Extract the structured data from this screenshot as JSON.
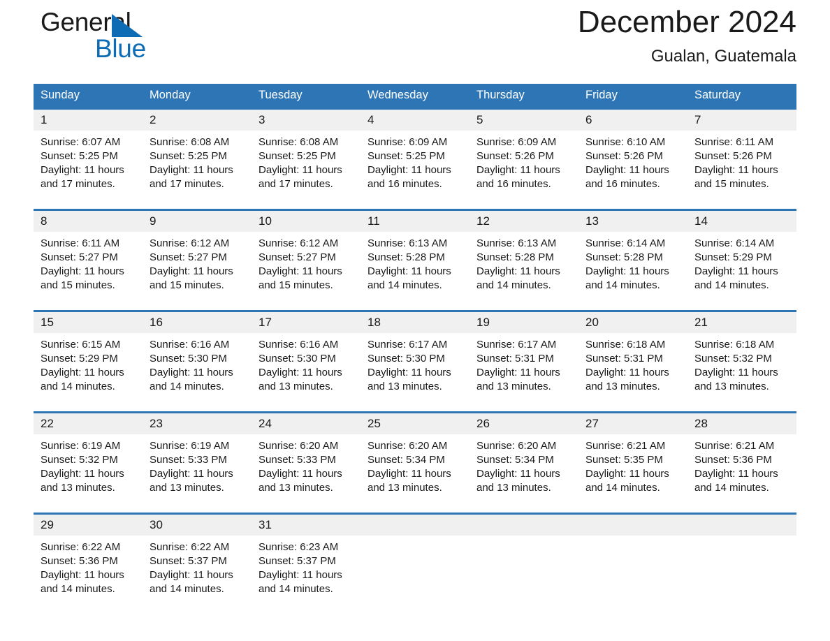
{
  "brand": {
    "word1": "General",
    "word2": "Blue",
    "triangle_color": "#0d6cb4",
    "word2_color": "#0c6cb6"
  },
  "header": {
    "month_title": "December 2024",
    "location": "Gualan, Guatemala"
  },
  "colors": {
    "header_blue": "#2e75b6",
    "daynum_gray": "#f0f0f0",
    "text": "#1a1a1a"
  },
  "calendar": {
    "weekday_headers": [
      "Sunday",
      "Monday",
      "Tuesday",
      "Wednesday",
      "Thursday",
      "Friday",
      "Saturday"
    ],
    "weeks": [
      [
        {
          "day": "1",
          "sunrise": "Sunrise: 6:07 AM",
          "sunset": "Sunset: 5:25 PM",
          "daylight1": "Daylight: 11 hours",
          "daylight2": "and 17 minutes."
        },
        {
          "day": "2",
          "sunrise": "Sunrise: 6:08 AM",
          "sunset": "Sunset: 5:25 PM",
          "daylight1": "Daylight: 11 hours",
          "daylight2": "and 17 minutes."
        },
        {
          "day": "3",
          "sunrise": "Sunrise: 6:08 AM",
          "sunset": "Sunset: 5:25 PM",
          "daylight1": "Daylight: 11 hours",
          "daylight2": "and 17 minutes."
        },
        {
          "day": "4",
          "sunrise": "Sunrise: 6:09 AM",
          "sunset": "Sunset: 5:25 PM",
          "daylight1": "Daylight: 11 hours",
          "daylight2": "and 16 minutes."
        },
        {
          "day": "5",
          "sunrise": "Sunrise: 6:09 AM",
          "sunset": "Sunset: 5:26 PM",
          "daylight1": "Daylight: 11 hours",
          "daylight2": "and 16 minutes."
        },
        {
          "day": "6",
          "sunrise": "Sunrise: 6:10 AM",
          "sunset": "Sunset: 5:26 PM",
          "daylight1": "Daylight: 11 hours",
          "daylight2": "and 16 minutes."
        },
        {
          "day": "7",
          "sunrise": "Sunrise: 6:11 AM",
          "sunset": "Sunset: 5:26 PM",
          "daylight1": "Daylight: 11 hours",
          "daylight2": "and 15 minutes."
        }
      ],
      [
        {
          "day": "8",
          "sunrise": "Sunrise: 6:11 AM",
          "sunset": "Sunset: 5:27 PM",
          "daylight1": "Daylight: 11 hours",
          "daylight2": "and 15 minutes."
        },
        {
          "day": "9",
          "sunrise": "Sunrise: 6:12 AM",
          "sunset": "Sunset: 5:27 PM",
          "daylight1": "Daylight: 11 hours",
          "daylight2": "and 15 minutes."
        },
        {
          "day": "10",
          "sunrise": "Sunrise: 6:12 AM",
          "sunset": "Sunset: 5:27 PM",
          "daylight1": "Daylight: 11 hours",
          "daylight2": "and 15 minutes."
        },
        {
          "day": "11",
          "sunrise": "Sunrise: 6:13 AM",
          "sunset": "Sunset: 5:28 PM",
          "daylight1": "Daylight: 11 hours",
          "daylight2": "and 14 minutes."
        },
        {
          "day": "12",
          "sunrise": "Sunrise: 6:13 AM",
          "sunset": "Sunset: 5:28 PM",
          "daylight1": "Daylight: 11 hours",
          "daylight2": "and 14 minutes."
        },
        {
          "day": "13",
          "sunrise": "Sunrise: 6:14 AM",
          "sunset": "Sunset: 5:28 PM",
          "daylight1": "Daylight: 11 hours",
          "daylight2": "and 14 minutes."
        },
        {
          "day": "14",
          "sunrise": "Sunrise: 6:14 AM",
          "sunset": "Sunset: 5:29 PM",
          "daylight1": "Daylight: 11 hours",
          "daylight2": "and 14 minutes."
        }
      ],
      [
        {
          "day": "15",
          "sunrise": "Sunrise: 6:15 AM",
          "sunset": "Sunset: 5:29 PM",
          "daylight1": "Daylight: 11 hours",
          "daylight2": "and 14 minutes."
        },
        {
          "day": "16",
          "sunrise": "Sunrise: 6:16 AM",
          "sunset": "Sunset: 5:30 PM",
          "daylight1": "Daylight: 11 hours",
          "daylight2": "and 14 minutes."
        },
        {
          "day": "17",
          "sunrise": "Sunrise: 6:16 AM",
          "sunset": "Sunset: 5:30 PM",
          "daylight1": "Daylight: 11 hours",
          "daylight2": "and 13 minutes."
        },
        {
          "day": "18",
          "sunrise": "Sunrise: 6:17 AM",
          "sunset": "Sunset: 5:30 PM",
          "daylight1": "Daylight: 11 hours",
          "daylight2": "and 13 minutes."
        },
        {
          "day": "19",
          "sunrise": "Sunrise: 6:17 AM",
          "sunset": "Sunset: 5:31 PM",
          "daylight1": "Daylight: 11 hours",
          "daylight2": "and 13 minutes."
        },
        {
          "day": "20",
          "sunrise": "Sunrise: 6:18 AM",
          "sunset": "Sunset: 5:31 PM",
          "daylight1": "Daylight: 11 hours",
          "daylight2": "and 13 minutes."
        },
        {
          "day": "21",
          "sunrise": "Sunrise: 6:18 AM",
          "sunset": "Sunset: 5:32 PM",
          "daylight1": "Daylight: 11 hours",
          "daylight2": "and 13 minutes."
        }
      ],
      [
        {
          "day": "22",
          "sunrise": "Sunrise: 6:19 AM",
          "sunset": "Sunset: 5:32 PM",
          "daylight1": "Daylight: 11 hours",
          "daylight2": "and 13 minutes."
        },
        {
          "day": "23",
          "sunrise": "Sunrise: 6:19 AM",
          "sunset": "Sunset: 5:33 PM",
          "daylight1": "Daylight: 11 hours",
          "daylight2": "and 13 minutes."
        },
        {
          "day": "24",
          "sunrise": "Sunrise: 6:20 AM",
          "sunset": "Sunset: 5:33 PM",
          "daylight1": "Daylight: 11 hours",
          "daylight2": "and 13 minutes."
        },
        {
          "day": "25",
          "sunrise": "Sunrise: 6:20 AM",
          "sunset": "Sunset: 5:34 PM",
          "daylight1": "Daylight: 11 hours",
          "daylight2": "and 13 minutes."
        },
        {
          "day": "26",
          "sunrise": "Sunrise: 6:20 AM",
          "sunset": "Sunset: 5:34 PM",
          "daylight1": "Daylight: 11 hours",
          "daylight2": "and 13 minutes."
        },
        {
          "day": "27",
          "sunrise": "Sunrise: 6:21 AM",
          "sunset": "Sunset: 5:35 PM",
          "daylight1": "Daylight: 11 hours",
          "daylight2": "and 14 minutes."
        },
        {
          "day": "28",
          "sunrise": "Sunrise: 6:21 AM",
          "sunset": "Sunset: 5:36 PM",
          "daylight1": "Daylight: 11 hours",
          "daylight2": "and 14 minutes."
        }
      ],
      [
        {
          "day": "29",
          "sunrise": "Sunrise: 6:22 AM",
          "sunset": "Sunset: 5:36 PM",
          "daylight1": "Daylight: 11 hours",
          "daylight2": "and 14 minutes."
        },
        {
          "day": "30",
          "sunrise": "Sunrise: 6:22 AM",
          "sunset": "Sunset: 5:37 PM",
          "daylight1": "Daylight: 11 hours",
          "daylight2": "and 14 minutes."
        },
        {
          "day": "31",
          "sunrise": "Sunrise: 6:23 AM",
          "sunset": "Sunset: 5:37 PM",
          "daylight1": "Daylight: 11 hours",
          "daylight2": "and 14 minutes."
        },
        {
          "day": "",
          "sunrise": "",
          "sunset": "",
          "daylight1": "",
          "daylight2": ""
        },
        {
          "day": "",
          "sunrise": "",
          "sunset": "",
          "daylight1": "",
          "daylight2": ""
        },
        {
          "day": "",
          "sunrise": "",
          "sunset": "",
          "daylight1": "",
          "daylight2": ""
        },
        {
          "day": "",
          "sunrise": "",
          "sunset": "",
          "daylight1": "",
          "daylight2": ""
        }
      ]
    ]
  }
}
